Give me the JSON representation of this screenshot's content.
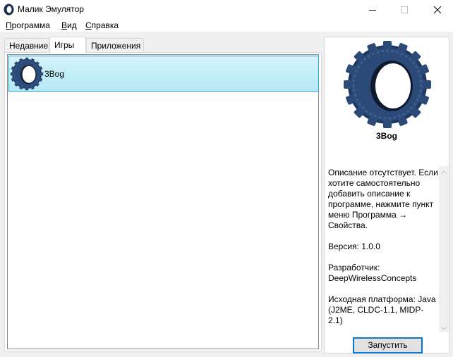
{
  "window": {
    "title": "Малик Эмулятор",
    "icons": {
      "app": "malik-app-icon",
      "minimize": "minimize-icon",
      "maximize": "maximize-icon",
      "close": "close-icon"
    }
  },
  "menu": {
    "program_hot": "П",
    "program_rest": "рограмма",
    "view_hot": "В",
    "view_rest": "ид",
    "help_hot": "С",
    "help_rest": "правка"
  },
  "tabs": [
    {
      "label": "Недавние",
      "active": false
    },
    {
      "label": "Игры",
      "active": true
    },
    {
      "label": "Приложения",
      "active": false
    }
  ],
  "list": {
    "items": [
      {
        "name": "3Bog",
        "icon": "gear-tire-icon",
        "selected": true
      }
    ]
  },
  "details": {
    "title": "3Bog",
    "icon": "gear-tire-icon",
    "description": "Описание отсутствует. Если хотите самостоятельно добавить описание к программе, нажмите пункт меню Программа → Свойства.",
    "version": "Версия: 1.0.0",
    "developer": "Разработчик: DeepWirelessConcepts",
    "platform": "Исходная платформа: Java (J2ME, CLDC-1.1, MIDP-2.1)",
    "run_label": "Запустить"
  },
  "colors": {
    "selection_fill": "#c3eef8",
    "selection_border": "#26a0da",
    "button_focus": "#0078d7",
    "icon_blue": "#2c4a78"
  }
}
